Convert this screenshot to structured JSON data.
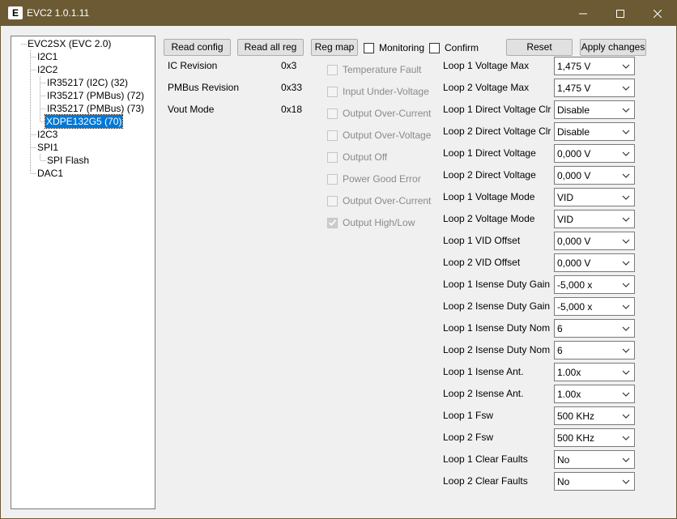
{
  "window": {
    "title": "EVC2 1.0.1.11",
    "app_icon_glyph": "E",
    "controls": [
      "minimize-icon",
      "maximize-icon",
      "close-icon"
    ]
  },
  "tree": {
    "nodes": [
      {
        "label": "EVC2SX (EVC 2.0)",
        "selected": false
      },
      {
        "label": "I2C1",
        "selected": false
      },
      {
        "label": "I2C2",
        "selected": false
      },
      {
        "label": "IR35217 (I2C) (32)",
        "selected": false
      },
      {
        "label": "IR35217 (PMBus) (72)",
        "selected": false
      },
      {
        "label": "IR35217 (PMBus) (73)",
        "selected": false
      },
      {
        "label": "XDPE132G5 (70)",
        "selected": true
      },
      {
        "label": "I2C3",
        "selected": false
      },
      {
        "label": "SPI1",
        "selected": false
      },
      {
        "label": "SPI Flash",
        "selected": false
      },
      {
        "label": "DAC1",
        "selected": false
      }
    ]
  },
  "toolbar": {
    "read_config": "Read config",
    "read_all_reg": "Read all reg",
    "reg_map": "Reg map",
    "monitoring": "Monitoring",
    "monitoring_checked": false,
    "confirm": "Confirm",
    "confirm_checked": false,
    "reset": "Reset",
    "apply_changes": "Apply changes"
  },
  "info": [
    {
      "label": "IC Revision",
      "value": "0x3"
    },
    {
      "label": "PMBus Revision",
      "value": "0x33"
    },
    {
      "label": "Vout Mode",
      "value": "0x18"
    }
  ],
  "status_flags": [
    {
      "label": "Temperature Fault",
      "checked": false
    },
    {
      "label": "Input Under-Voltage",
      "checked": false
    },
    {
      "label": "Output Over-Current",
      "checked": false
    },
    {
      "label": "Output Over-Voltage",
      "checked": false
    },
    {
      "label": "Output Off",
      "checked": false
    },
    {
      "label": "Power Good Error",
      "checked": false
    },
    {
      "label": "Output Over-Current",
      "checked": false
    },
    {
      "label": "Output High/Low",
      "checked": true
    }
  ],
  "params": [
    {
      "label": "Loop 1 Voltage Max",
      "value": "1,475 V"
    },
    {
      "label": "Loop 2 Voltage Max",
      "value": "1,475 V"
    },
    {
      "label": "Loop 1 Direct Voltage Clr",
      "value": "Disable"
    },
    {
      "label": "Loop 2 Direct Voltage Clr",
      "value": "Disable"
    },
    {
      "label": "Loop 1 Direct Voltage",
      "value": "0,000 V"
    },
    {
      "label": "Loop 2 Direct Voltage",
      "value": "0,000 V"
    },
    {
      "label": "Loop 1 Voltage Mode",
      "value": "VID"
    },
    {
      "label": "Loop 2 Voltage Mode",
      "value": "VID"
    },
    {
      "label": "Loop 1 VID Offset",
      "value": "0,000 V"
    },
    {
      "label": "Loop 2 VID Offset",
      "value": "0,000 V"
    },
    {
      "label": "Loop 1 Isense Duty Gain",
      "value": "-5,000 x"
    },
    {
      "label": "Loop 2 Isense Duty Gain",
      "value": "-5,000 x"
    },
    {
      "label": "Loop 1 Isense Duty Nom",
      "value": "6"
    },
    {
      "label": "Loop 2 Isense Duty Nom",
      "value": "6"
    },
    {
      "label": "Loop 1 Isense Ant.",
      "value": "1.00x"
    },
    {
      "label": "Loop 2 Isense Ant.",
      "value": "1.00x"
    },
    {
      "label": "Loop 1 Fsw",
      "value": "500 KHz"
    },
    {
      "label": "Loop 2 Fsw",
      "value": "500 KHz"
    },
    {
      "label": "Loop 1 Clear Faults",
      "value": "No"
    },
    {
      "label": "Loop 2 Clear Faults",
      "value": "No"
    }
  ]
}
